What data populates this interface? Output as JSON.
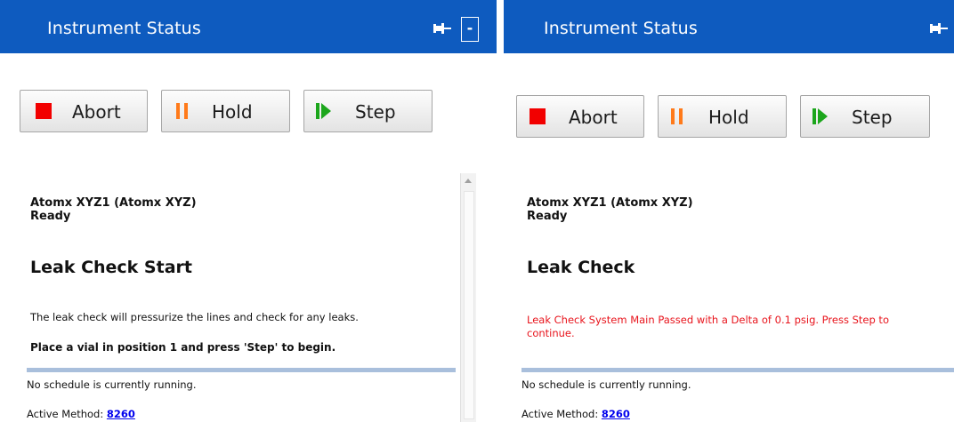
{
  "panels": [
    {
      "header": {
        "title": "Instrument Status",
        "minimize_label": "-"
      },
      "buttons": {
        "abort": "Abort",
        "hold": "Hold",
        "step": "Step"
      },
      "instrument": {
        "name": "Atomx XYZ1 (Atomx XYZ)",
        "state": "Ready"
      },
      "section_title": "Leak Check Start",
      "description": "The leak check will pressurize the lines and check for any leaks.",
      "instruction": "Place a vial in position 1 and press 'Step' to begin.",
      "schedule_status": "No schedule is currently running.",
      "active_method_label": "Active Method:",
      "active_method_value": "8260"
    },
    {
      "header": {
        "title": "Instrument Status"
      },
      "buttons": {
        "abort": "Abort",
        "hold": "Hold",
        "step": "Step"
      },
      "instrument": {
        "name": "Atomx XYZ1 (Atomx XYZ)",
        "state": "Ready"
      },
      "section_title": "Leak Check",
      "description": "Leak Check System Main Passed with a Delta of 0.1 psig. Press Step to continue.",
      "schedule_status": "No schedule is currently running.",
      "active_method_label": "Active Method:",
      "active_method_value": "8260"
    }
  ],
  "colors": {
    "header_bg": "#0e5bbf",
    "abort_icon": "#f20000",
    "hold_icon": "#ff7a1a",
    "step_icon": "#1ca61c",
    "status_message_red": "#e8141c",
    "link": "#0000ee"
  },
  "icons": [
    "pin-icon",
    "stop-icon",
    "pause-icon",
    "step-forward-icon",
    "scroll-up-icon"
  ]
}
